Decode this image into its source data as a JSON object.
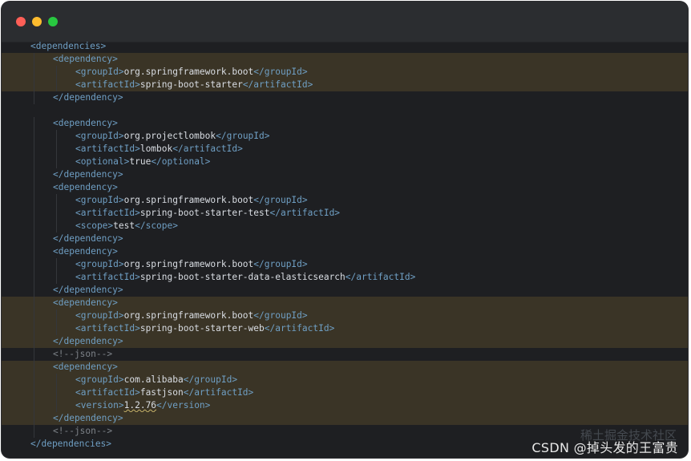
{
  "window": {
    "buttons": [
      "close",
      "minimize",
      "maximize"
    ],
    "colors": {
      "close": "#ff5f57",
      "minimize": "#febc2e",
      "maximize": "#28c840",
      "background": "#1e1f22",
      "highlight": "#3a3426"
    }
  },
  "code": {
    "lines": [
      {
        "indent": 0,
        "type": "open",
        "tag": "dependencies",
        "hl": false
      },
      {
        "indent": 1,
        "type": "open",
        "tag": "dependency",
        "hl": true
      },
      {
        "indent": 2,
        "type": "elem",
        "tag": "groupId",
        "value": "org.springframework.boot",
        "hl": true
      },
      {
        "indent": 2,
        "type": "elem",
        "tag": "artifactId",
        "value": "spring-boot-starter",
        "hl": true
      },
      {
        "indent": 1,
        "type": "close",
        "tag": "dependency",
        "hl": false
      },
      {
        "indent": 0,
        "type": "blank",
        "hl": false
      },
      {
        "indent": 1,
        "type": "open",
        "tag": "dependency",
        "hl": false
      },
      {
        "indent": 2,
        "type": "elem",
        "tag": "groupId",
        "value": "org.projectlombok",
        "hl": false
      },
      {
        "indent": 2,
        "type": "elem",
        "tag": "artifactId",
        "value": "lombok",
        "hl": false
      },
      {
        "indent": 2,
        "type": "elem",
        "tag": "optional",
        "value": "true",
        "hl": false
      },
      {
        "indent": 1,
        "type": "close",
        "tag": "dependency",
        "hl": false
      },
      {
        "indent": 1,
        "type": "open",
        "tag": "dependency",
        "hl": false
      },
      {
        "indent": 2,
        "type": "elem",
        "tag": "groupId",
        "value": "org.springframework.boot",
        "hl": false
      },
      {
        "indent": 2,
        "type": "elem",
        "tag": "artifactId",
        "value": "spring-boot-starter-test",
        "hl": false
      },
      {
        "indent": 2,
        "type": "elem",
        "tag": "scope",
        "value": "test",
        "hl": false
      },
      {
        "indent": 1,
        "type": "close",
        "tag": "dependency",
        "hl": false
      },
      {
        "indent": 1,
        "type": "open",
        "tag": "dependency",
        "hl": false
      },
      {
        "indent": 2,
        "type": "elem",
        "tag": "groupId",
        "value": "org.springframework.boot",
        "hl": false
      },
      {
        "indent": 2,
        "type": "elem",
        "tag": "artifactId",
        "value": "spring-boot-starter-data-elasticsearch",
        "hl": false
      },
      {
        "indent": 1,
        "type": "close",
        "tag": "dependency",
        "hl": false
      },
      {
        "indent": 1,
        "type": "open",
        "tag": "dependency",
        "hl": true
      },
      {
        "indent": 2,
        "type": "elem",
        "tag": "groupId",
        "value": "org.springframework.boot",
        "hl": true
      },
      {
        "indent": 2,
        "type": "elem",
        "tag": "artifactId",
        "value": "spring-boot-starter-web",
        "hl": true
      },
      {
        "indent": 1,
        "type": "close",
        "tag": "dependency",
        "hl": true
      },
      {
        "indent": 1,
        "type": "comment",
        "text": "<!--json-->",
        "hl": false
      },
      {
        "indent": 1,
        "type": "open",
        "tag": "dependency",
        "hl": true
      },
      {
        "indent": 2,
        "type": "elem",
        "tag": "groupId",
        "value": "com.alibaba",
        "hl": true
      },
      {
        "indent": 2,
        "type": "elem",
        "tag": "artifactId",
        "value": "fastjson",
        "hl": true
      },
      {
        "indent": 2,
        "type": "elem",
        "tag": "version",
        "value": "1.2.76",
        "wavy": true,
        "hl": true
      },
      {
        "indent": 1,
        "type": "close",
        "tag": "dependency",
        "hl": true
      },
      {
        "indent": 1,
        "type": "comment",
        "text": "<!--json-->",
        "hl": false
      },
      {
        "indent": 0,
        "type": "close",
        "tag": "dependencies",
        "hl": false
      }
    ]
  },
  "watermark": {
    "text": "CSDN @掉头发的王富贵",
    "shadow_text": "稀土掘金技术社区"
  }
}
